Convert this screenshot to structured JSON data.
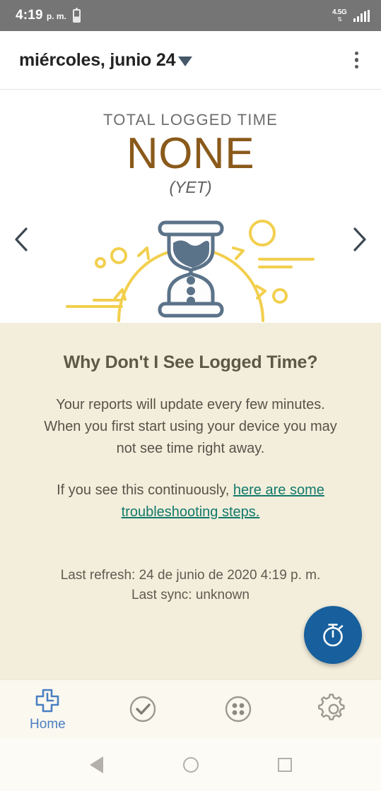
{
  "status_bar": {
    "time": "4:19",
    "ampm": "p. m.",
    "network_label": "4.5G",
    "network_arrows": "⇅",
    "battery_icon": "battery-icon",
    "signal_icon": "signal-bars-icon"
  },
  "app_bar": {
    "title": "miércoles, junio 24",
    "dropdown_icon": "chevron-down-icon",
    "overflow_icon": "overflow-menu-icon"
  },
  "hero": {
    "label": "TOTAL LOGGED TIME",
    "value": "NONE",
    "sub": "(YET)",
    "prev_icon": "chevron-left-icon",
    "next_icon": "chevron-right-icon",
    "illustration_name": "hourglass-illustration",
    "value_color": "#8a5a1b",
    "illustration_accent": "#f2cf4e",
    "illustration_outline": "#5b7389"
  },
  "info": {
    "heading": "Why Don't I See Logged Time?",
    "body": "Your reports will update every few minutes. When you first start using your device you may not see time right away.",
    "link_prefix": "If you see this continuously, ",
    "link_text": "here are some troubleshooting steps.",
    "link_color": "#12796b",
    "last_refresh": "Last refresh: 24 de junio de 2020 4:19 p. m.",
    "last_sync": "Last sync: unknown",
    "background": "#f3eedc"
  },
  "fab": {
    "name": "start-timer-fab",
    "icon": "stopwatch-icon",
    "color": "#17609d"
  },
  "bottom_nav": {
    "items": [
      {
        "label": "Home",
        "icon": "home-clock-icon",
        "active": true
      },
      {
        "label": "",
        "icon": "check-circle-icon",
        "active": false
      },
      {
        "label": "",
        "icon": "four-dots-circle-icon",
        "active": false
      },
      {
        "label": "",
        "icon": "gear-icon",
        "active": false
      }
    ],
    "active_color": "#4a7fc1",
    "inactive_color": "#9c998f"
  },
  "android_nav": {
    "back_icon": "back-triangle-icon",
    "home_icon": "home-circle-icon",
    "recents_icon": "recents-square-icon"
  }
}
